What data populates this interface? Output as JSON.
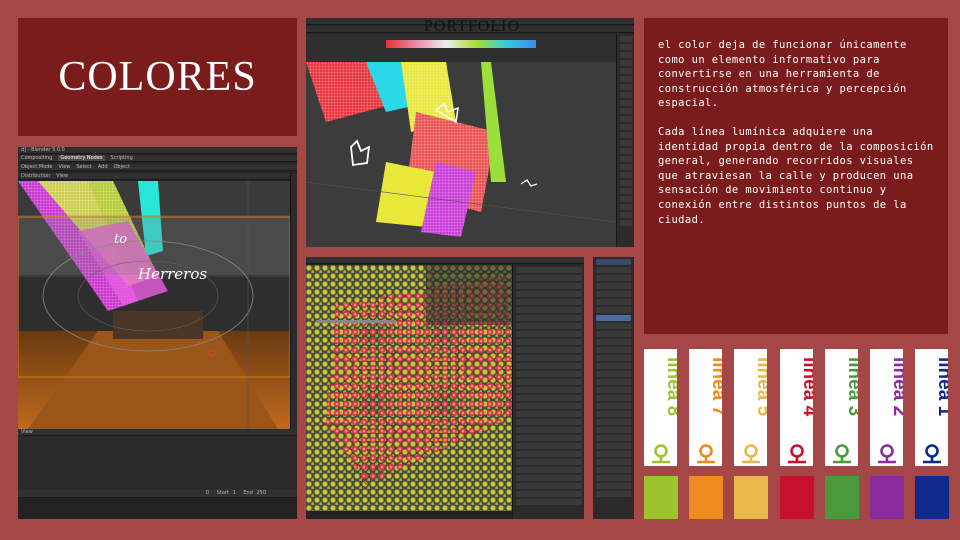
{
  "title": "COLORES",
  "portfolio": "PORTFOLIO",
  "paragraphs": [
    "el color deja de funcionar únicamente como un elemento informativo para convertirse en una herramienta de construcción atmosférica y percepción espacial.",
    "Cada línea lumínica adquiere una identidad propia dentro de la composición general, generando recorridos visuales que atraviesan la calle y producen una sensación de movimiento continuo y conexión entre distintos puntos de la ciudad."
  ],
  "blender": {
    "window_title": "d] - Blender 5.0.0",
    "tabs": [
      "Compositing",
      "Geometry Nodes",
      "Scripting"
    ],
    "active_tab": "Geometry Nodes",
    "menu": [
      "Object Mode",
      "View",
      "Select",
      "Add",
      "Object"
    ],
    "header_menu": [
      "Distribution",
      "View"
    ],
    "neon_text_1": "to",
    "neon_text_2": "Herreros",
    "timeline_label": "View",
    "frame_start_label": "Start",
    "frame_start": "1",
    "frame_end_label": "End",
    "frame_end": "250",
    "frame_current": "0"
  },
  "lines": [
    {
      "name": "línea 8",
      "color": "#9dc32f"
    },
    {
      "name": "línea 7",
      "color": "#ef8a1e"
    },
    {
      "name": "línea 5",
      "color": "#e8b84b"
    },
    {
      "name": "línea 4",
      "color": "#c8102e"
    },
    {
      "name": "línea 3",
      "color": "#4a9a3b"
    },
    {
      "name": "línea 2",
      "color": "#8b2a9a"
    },
    {
      "name": "línea 1",
      "color": "#0f2a8c"
    }
  ]
}
